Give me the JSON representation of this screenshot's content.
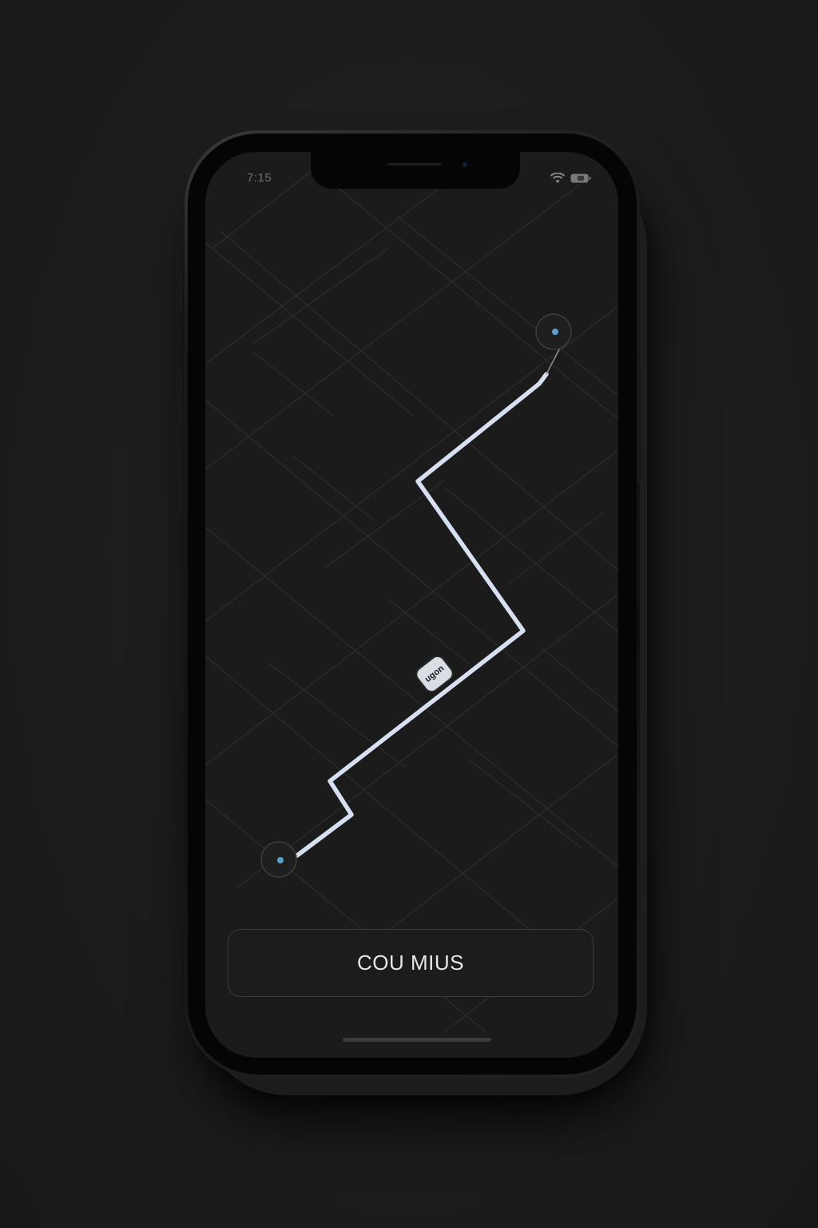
{
  "status_bar": {
    "time": "7:15"
  },
  "map": {
    "route_badge_label": "ugon",
    "route_color": "#d6e0f0",
    "start_marker_icon": "location-pin-icon",
    "end_marker_icon": "location-pin-icon"
  },
  "action": {
    "button_label": "COU MIUS"
  },
  "icons": {
    "wifi": "wifi-icon",
    "battery": "battery-icon"
  }
}
